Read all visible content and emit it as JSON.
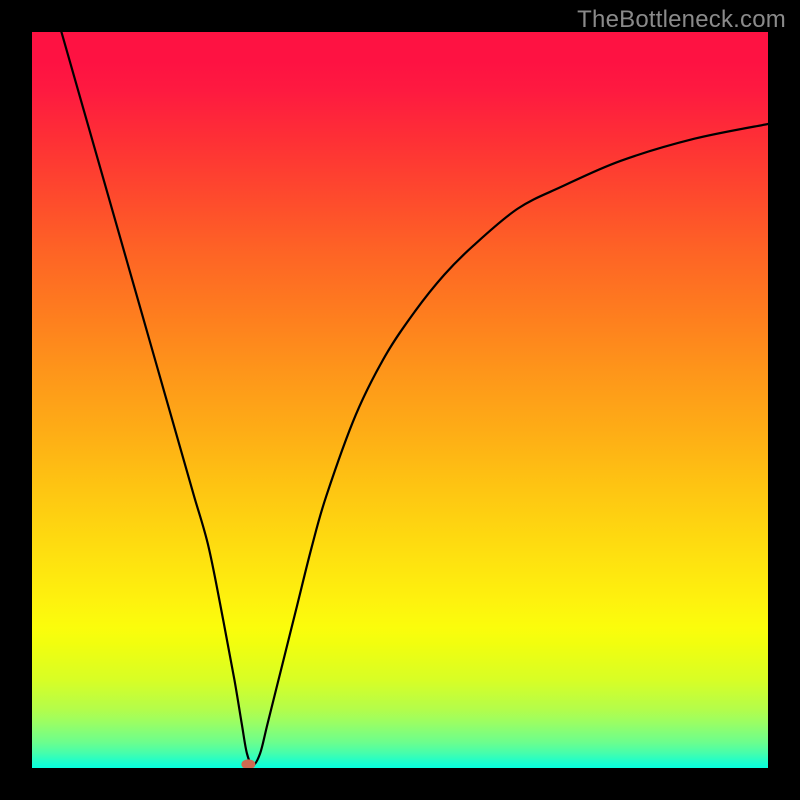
{
  "watermark": "TheBottleneck.com",
  "chart_data": {
    "type": "line",
    "title": "",
    "xlabel": "",
    "ylabel": "",
    "xlim": [
      0,
      100
    ],
    "ylim": [
      0,
      100
    ],
    "grid": false,
    "legend": false,
    "annotations": [],
    "series": [
      {
        "name": "bottleneck-curve",
        "color": "#000000",
        "x": [
          4,
          6,
          8,
          10,
          12,
          14,
          16,
          18,
          20,
          22,
          24,
          26,
          27.5,
          28.5,
          29.2,
          30,
          31,
          32,
          34,
          36,
          38,
          40,
          44,
          48,
          52,
          56,
          60,
          66,
          72,
          80,
          90,
          100
        ],
        "y": [
          100,
          93,
          86,
          79,
          72,
          65,
          58,
          51,
          44,
          37,
          30,
          20,
          12,
          6,
          2,
          0.4,
          2,
          6,
          14,
          22,
          30,
          37,
          48,
          56,
          62,
          67,
          71,
          76,
          79,
          82.5,
          85.5,
          87.5
        ]
      }
    ],
    "marker": {
      "name": "optimum-marker",
      "x": 29.4,
      "y": 0.5,
      "color": "#cf6a51",
      "rx": 7,
      "ry": 5
    }
  }
}
